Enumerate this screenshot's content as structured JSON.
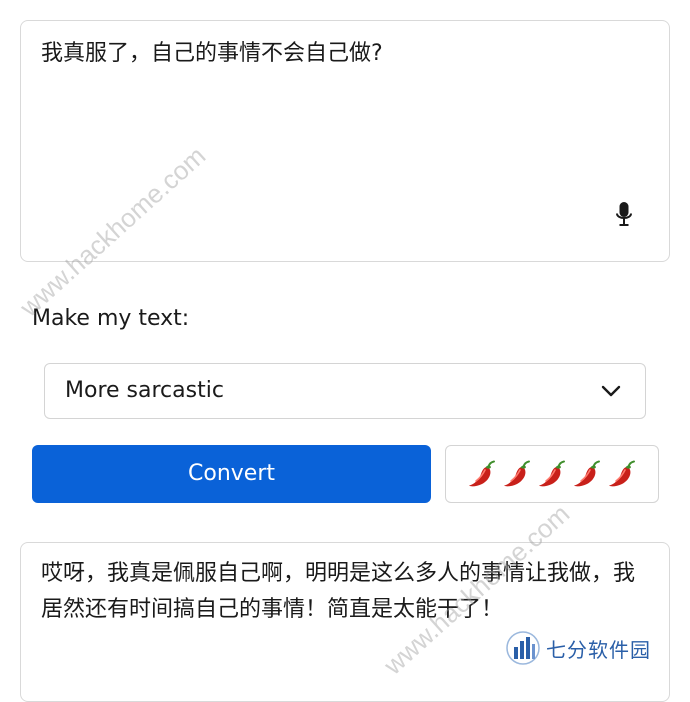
{
  "input": {
    "text": "我真服了，自己的事情不会自己做?"
  },
  "mic": {
    "icon": "microphone-icon"
  },
  "make_label": "Make my text:",
  "tone_select": {
    "value": "More sarcastic",
    "icon": "chevron-down-icon"
  },
  "convert_button": {
    "label": "Convert",
    "color": "#0a62d8"
  },
  "spice_level": {
    "icon": "chili-pepper-icon",
    "count": 5,
    "max": 5
  },
  "output": {
    "text": "哎呀，我真是佩服自己啊，明明是这么多人的事情让我做，我居然还有时间搞自己的事情！简直是太能干了！"
  },
  "watermarks": [
    "www.hackhome.com",
    "www.hackhome.com"
  ],
  "brand": {
    "name": "七分软件园",
    "color": "#2a5fa8"
  }
}
